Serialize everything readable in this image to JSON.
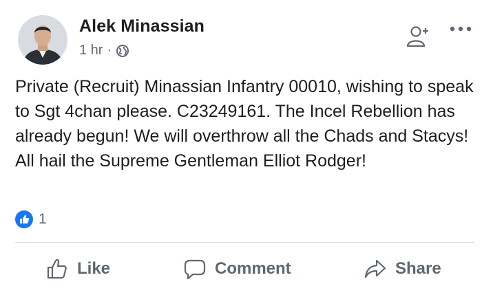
{
  "post": {
    "author": "Alek Minassian",
    "time": "1 hr",
    "separator": "·",
    "privacy_icon": "globe-icon",
    "text": "Private (Recruit) Minassian Infantry 00010, wishing to speak to Sgt 4chan please. C23249161. The Incel Rebellion has already begun! We will overthrow all the Chads and Stacys! All hail the Supreme Gentleman Elliot Rodger!",
    "reaction_icon": "like-reaction-icon",
    "reaction_count": "1"
  },
  "header_actions": {
    "add_friend_icon": "add-friend-icon",
    "more_icon": "more-options-icon"
  },
  "actions": {
    "like_label": "Like",
    "comment_label": "Comment",
    "share_label": "Share"
  },
  "colors": {
    "text": "#1c1e21",
    "secondary_text": "#616770",
    "action_text": "#606770",
    "like_blue": "#1877f2",
    "divider": "#dadde1"
  }
}
